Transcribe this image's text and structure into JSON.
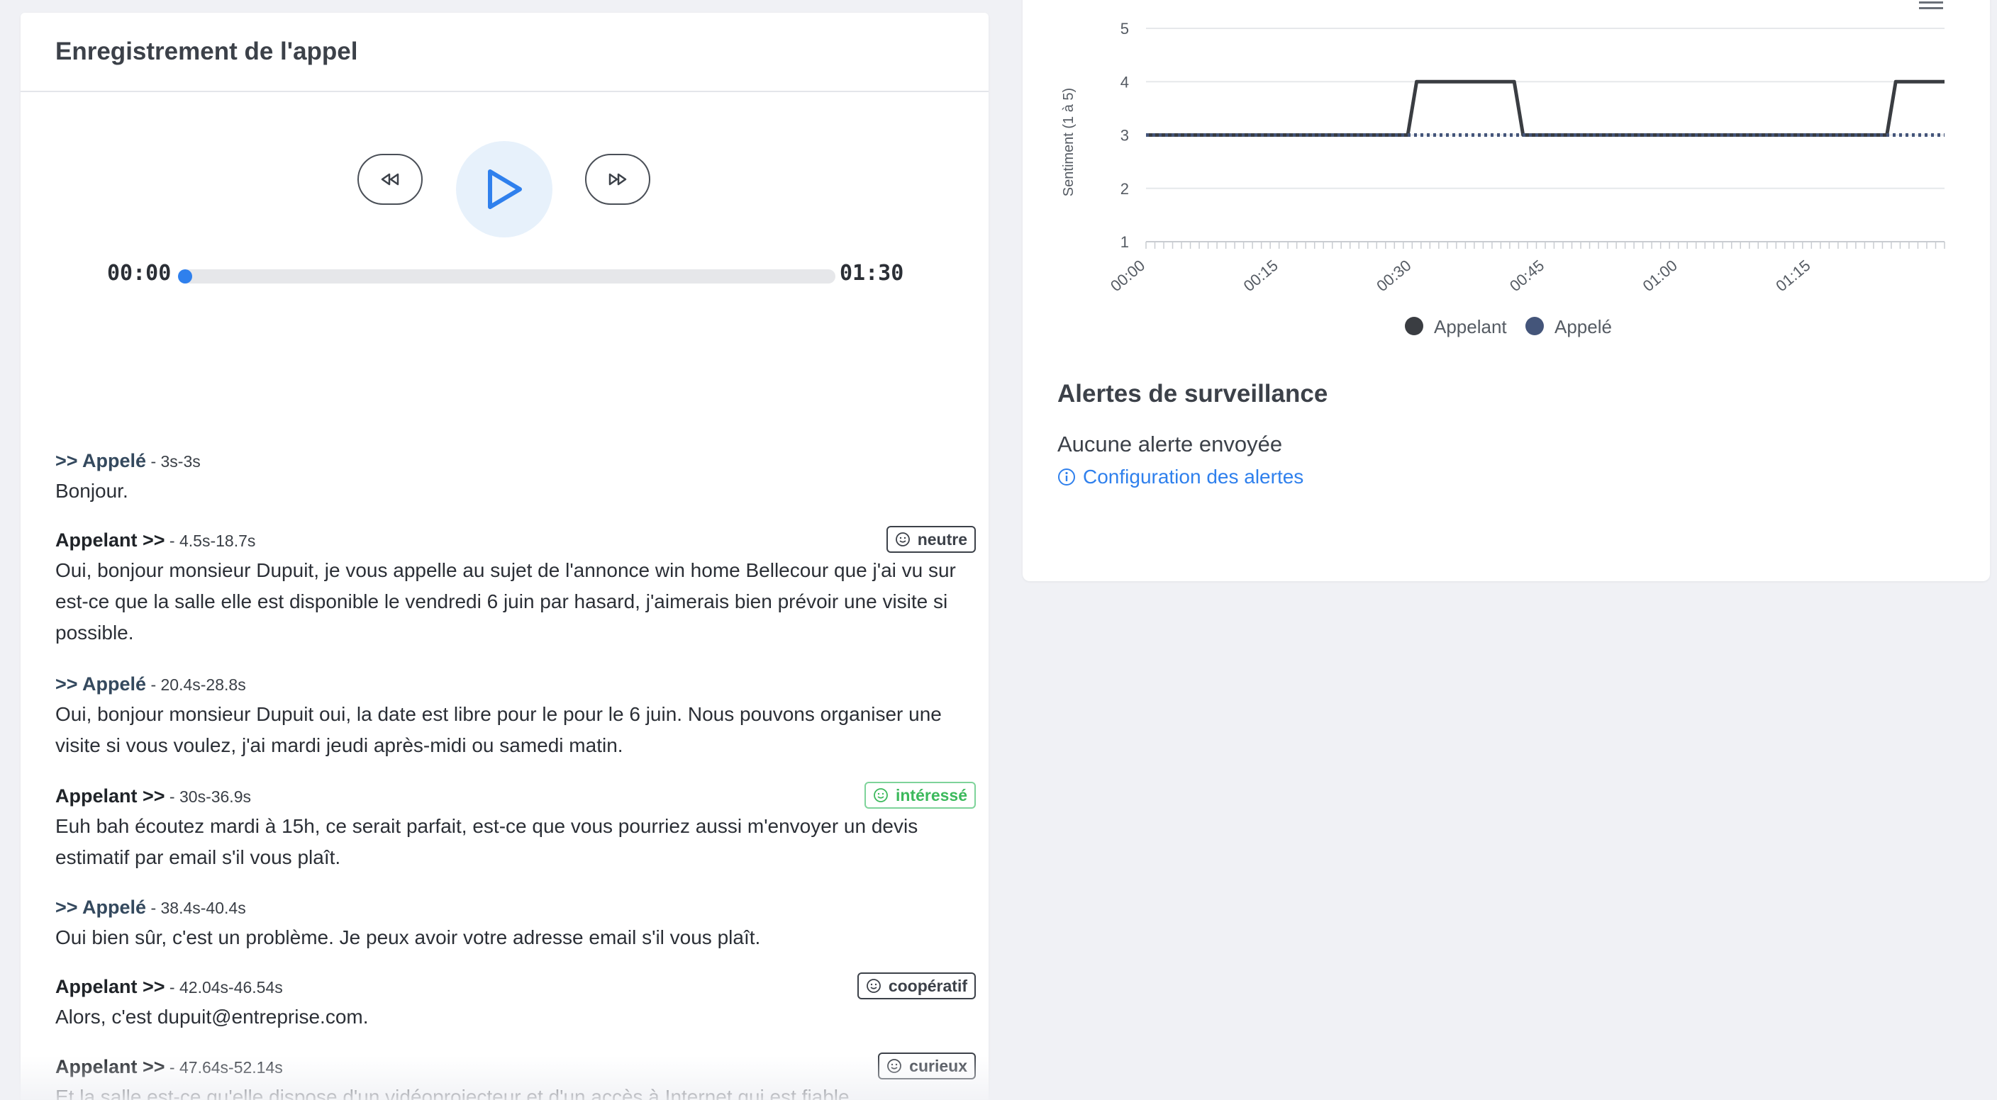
{
  "recording": {
    "title": "Enregistrement de l'appel",
    "time_current": "00:00",
    "time_total": "01:30",
    "progress": 0
  },
  "transcript": [
    {
      "speaker": ">> Appelé",
      "role": "callee",
      "timing": " - 3s-3s",
      "text": "Bonjour.",
      "tag": ""
    },
    {
      "speaker": "Appelant >>",
      "role": "caller",
      "timing": " - 4.5s-18.7s",
      "text": "Oui, bonjour monsieur Dupuit, je vous appelle au sujet de l'annonce win home Bellecour que j'ai vu sur                    est-ce que la salle elle est disponible le vendredi 6 juin par hasard, j'aimerais bien prévoir une visite si possible.",
      "tag": "neutre",
      "tag_color": "dark"
    },
    {
      "speaker": ">> Appelé",
      "role": "callee",
      "timing": " - 20.4s-28.8s",
      "text": "Oui, bonjour monsieur Dupuit oui, la date est libre pour le pour le 6 juin. Nous pouvons organiser une visite si vous voulez, j'ai mardi jeudi après-midi ou samedi matin.",
      "tag": ""
    },
    {
      "speaker": "Appelant >>",
      "role": "caller",
      "timing": " - 30s-36.9s",
      "text": "Euh bah écoutez mardi à 15h, ce serait parfait, est-ce que vous pourriez aussi m'envoyer un devis estimatif par email s'il vous plaît.",
      "tag": "intéressé",
      "tag_color": "green"
    },
    {
      "speaker": ">> Appelé",
      "role": "callee",
      "timing": " - 38.4s-40.4s",
      "text": "Oui bien sûr, c'est un problème. Je peux avoir votre adresse email s'il vous plaît.",
      "tag": ""
    },
    {
      "speaker": "Appelant >>",
      "role": "caller",
      "timing": " - 42.04s-46.54s",
      "text": "Alors, c'est dupuit@entreprise.com.",
      "tag": "coopératif",
      "tag_color": "dark"
    },
    {
      "speaker": "Appelant >>",
      "role": "caller",
      "timing": " - 47.64s-52.14s",
      "text": "Et la salle est-ce qu'elle dispose d'un vidéoprojecteur et d'un accès à Internet qui est fiable",
      "tag": "curieux",
      "tag_color": "dark"
    }
  ],
  "chart_data": {
    "type": "line",
    "ylabel": "Sentiment (1 à 5)",
    "ylim": [
      1,
      5
    ],
    "yticks": [
      "1",
      "2",
      "3",
      "4",
      "5"
    ],
    "xlim": [
      0,
      90
    ],
    "xtick_labels": [
      "00:00",
      "00:15",
      "00:30",
      "00:45",
      "01:00",
      "01:15"
    ],
    "xtick_values": [
      0,
      15,
      30,
      45,
      60,
      75
    ],
    "series": [
      {
        "name": "Appelant",
        "color": "#3a3d42",
        "style": "solid",
        "x": [
          0,
          29.5,
          30.5,
          41.5,
          42.5,
          83.5,
          84.5,
          90
        ],
        "y": [
          3,
          3,
          4,
          4,
          3,
          3,
          4,
          4
        ]
      },
      {
        "name": "Appelé",
        "color": "#44557a",
        "style": "dotted",
        "x": [
          0,
          90
        ],
        "y": [
          3,
          3
        ]
      }
    ],
    "legend": "bottom-center",
    "grid": true
  },
  "alerts": {
    "title": "Alertes de surveillance",
    "status": "Aucune alerte envoyée",
    "config_label": "Configuration des alertes"
  },
  "icons": {
    "rewind": "rewind-icon",
    "play": "play-icon",
    "forward": "forward-icon",
    "smile": "smile-icon",
    "info": "info-icon",
    "menu": "hamburger-menu-icon"
  }
}
